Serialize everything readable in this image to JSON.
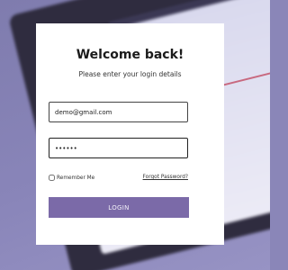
{
  "login": {
    "title": "Welcome back!",
    "subtitle": "Please enter your login details",
    "email_value": "demo@gmail.com",
    "password_value": "••••••",
    "remember_label": "Remember Me",
    "forgot_label": "Forgot Password?",
    "login_button_label": "LOGIN"
  },
  "colors": {
    "accent": "#7b6aa8",
    "background": "#8a86b8",
    "card": "#ffffff"
  }
}
